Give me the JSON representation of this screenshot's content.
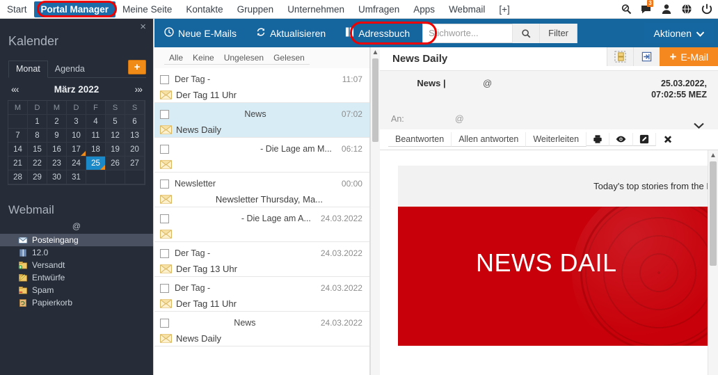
{
  "topnav": {
    "items": [
      {
        "label": "Start",
        "active": false
      },
      {
        "label": "Portal Manager",
        "active": true
      },
      {
        "label": "Meine Seite",
        "active": false
      },
      {
        "label": "Kontakte",
        "active": false
      },
      {
        "label": "Gruppen",
        "active": false
      },
      {
        "label": "Unternehmen",
        "active": false
      },
      {
        "label": "Umfragen",
        "active": false
      },
      {
        "label": "Apps",
        "active": false
      },
      {
        "label": "Webmail",
        "active": false
      },
      {
        "label": "[+]",
        "active": false
      }
    ],
    "icons": [
      {
        "name": "search-icon"
      },
      {
        "name": "messages-icon",
        "badge": "3"
      },
      {
        "name": "user-icon"
      },
      {
        "name": "globe-icon"
      },
      {
        "name": "power-icon"
      }
    ],
    "badge_color": "#f07818",
    "active_color": "#1b6ca8"
  },
  "annotations": {
    "ring_color": "#ef0000",
    "targets": [
      "Portal Manager",
      "Adressbuch"
    ]
  },
  "sidebar": {
    "close_label": "×",
    "calendar": {
      "title": "Kalender",
      "tabs": [
        {
          "label": "Monat",
          "active": true
        },
        {
          "label": "Agenda",
          "active": false
        }
      ],
      "add_label": "+",
      "prev_labels": "«‹",
      "next_labels": "›»",
      "month": "März 2022",
      "dow": [
        "M",
        "D",
        "M",
        "D",
        "F",
        "S",
        "S"
      ],
      "leading_blanks": 1,
      "days": [
        1,
        2,
        3,
        4,
        5,
        6,
        7,
        8,
        9,
        10,
        11,
        12,
        13,
        14,
        15,
        16,
        17,
        18,
        19,
        20,
        21,
        22,
        23,
        24,
        25,
        26,
        27,
        28,
        29,
        30,
        31
      ],
      "selected_day": 25,
      "marked_days": [
        17,
        25
      ],
      "selected_color": "#1b89c8",
      "marker_color": "#f08b18"
    },
    "webmail": {
      "title": "Webmail",
      "account": "@",
      "folders": [
        {
          "label": "Posteingang",
          "icon": "inbox-icon",
          "selected": true
        },
        {
          "label": "12.0",
          "icon": "folder-icon",
          "selected": false
        },
        {
          "label": "Versandt",
          "icon": "sent-folder-icon",
          "selected": false
        },
        {
          "label": "Entwürfe",
          "icon": "drafts-folder-icon",
          "selected": false
        },
        {
          "label": "Spam",
          "icon": "spam-folder-icon",
          "selected": false
        },
        {
          "label": "Papierkorb",
          "icon": "trash-folder-icon",
          "selected": false
        }
      ]
    }
  },
  "toolbar": {
    "background": "#15659f",
    "new_mails_label": "Neue E-Mails",
    "new_mails_icon": "clock-icon",
    "refresh_label": "Aktualisieren",
    "refresh_icon": "refresh-icon",
    "addressbook_label": "Adressbuch",
    "addressbook_icon": "book-icon",
    "search_placeholder": "Stichworte...",
    "search_value": "",
    "search_icon": "search-icon",
    "filter_label": "Filter",
    "actions_label": "Aktionen",
    "actions_caret": "⌄",
    "subbar_icons": [
      {
        "name": "contacts-copy-icon"
      },
      {
        "name": "import-icon"
      }
    ],
    "email_label": "E-Mail",
    "email_plus": "+",
    "email_color": "#f5891f"
  },
  "maillist": {
    "filters": [
      "Alle",
      "Keine",
      "Ungelesen",
      "Gelesen"
    ],
    "rows": [
      {
        "from": "Der Tag -",
        "from_align": "left",
        "time": "11:07",
        "subject": "Der Tag 11 Uhr",
        "subject_align": "left",
        "selected": false
      },
      {
        "from": "News",
        "from_align": "center",
        "time": "07:02",
        "subject": "News Daily",
        "subject_align": "left",
        "selected": true
      },
      {
        "from": "- Die Lage am M...",
        "from_align": "right",
        "time": "06:12",
        "subject": "",
        "subject_align": "left",
        "selected": false
      },
      {
        "from": "Newsletter",
        "from_align": "left",
        "time": "00:00",
        "subject": "Newsletter Thursday, Ma...",
        "subject_align": "center",
        "selected": false
      },
      {
        "from": "- Die Lage am A...",
        "from_align": "right",
        "time": "24.03.2022",
        "subject": "",
        "subject_align": "left",
        "selected": false
      },
      {
        "from": "Der Tag -",
        "from_align": "left",
        "time": "24.03.2022",
        "subject": "Der Tag 13 Uhr",
        "subject_align": "left",
        "selected": false
      },
      {
        "from": "Der Tag -",
        "from_align": "left",
        "time": "24.03.2022",
        "subject": "Der Tag 11 Uhr",
        "subject_align": "left",
        "selected": false
      },
      {
        "from": "News",
        "from_align": "center",
        "time": "24.03.2022",
        "subject": "News Daily",
        "subject_align": "left",
        "selected": false
      }
    ],
    "selected_color": "#d8ecf5"
  },
  "reader": {
    "title": "News Daily",
    "from": "News |",
    "from_at": "@",
    "date": "25.03.2022,",
    "time": "07:02:55 MEZ",
    "to_label": "An:",
    "to_value": "@",
    "expand_icon": "chevron-down-icon",
    "actions": [
      {
        "label": "Beantworten",
        "type": "text"
      },
      {
        "label": "Allen antworten",
        "type": "text"
      },
      {
        "label": "Weiterleiten",
        "type": "text"
      },
      {
        "label": "",
        "type": "icon",
        "icon": "print-icon"
      },
      {
        "label": "",
        "type": "icon",
        "icon": "eye-icon"
      },
      {
        "label": "",
        "type": "icon",
        "icon": "edit-icon"
      },
      {
        "label": "",
        "type": "icon",
        "icon": "close-icon"
      }
    ],
    "body": {
      "preheader": "Today's top stories from the E",
      "banner_title": "NEWS DAIL",
      "banner_color": "#c8000a"
    }
  }
}
